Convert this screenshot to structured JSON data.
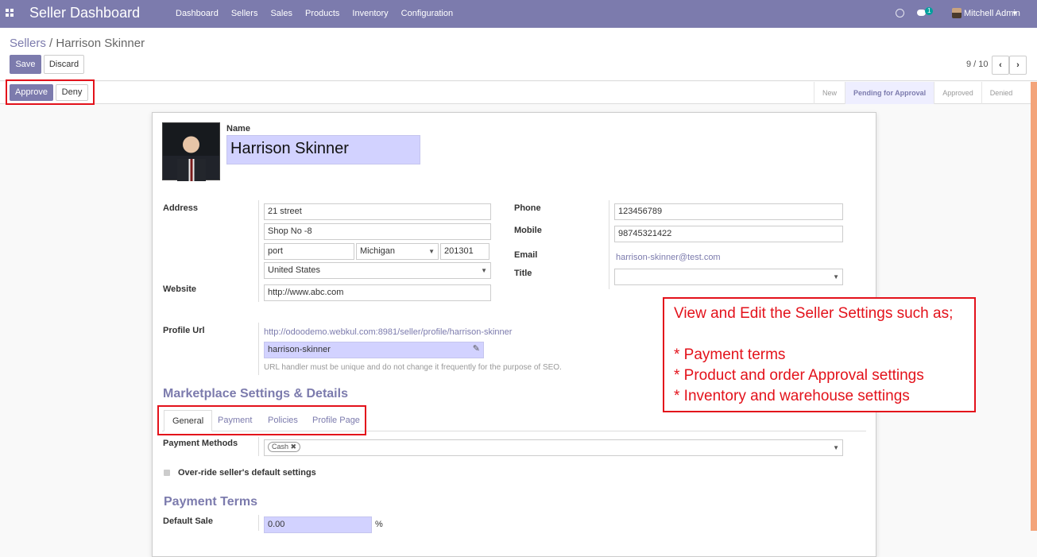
{
  "navbar": {
    "brand": "Seller Dashboard",
    "menu": [
      "Dashboard",
      "Sellers",
      "Sales",
      "Products",
      "Inventory",
      "Configuration"
    ],
    "chat_count": "1",
    "user": "Mitchell Admin"
  },
  "breadcrumb": {
    "parent": "Sellers",
    "separator": " / ",
    "current": "Harrison Skinner"
  },
  "toolbar": {
    "save": "Save",
    "discard": "Discard"
  },
  "pager": {
    "text": "9 / 10"
  },
  "status": {
    "approve": "Approve",
    "deny": "Deny",
    "steps": [
      "New",
      "Pending for Approval",
      "Approved",
      "Denied"
    ],
    "active": "Pending for Approval"
  },
  "form": {
    "name_label": "Name",
    "name": "Harrison Skinner",
    "address_label": "Address",
    "street": "21 street",
    "street2": "Shop No -8",
    "city": "port",
    "state": "Michigan",
    "zip": "201301",
    "country": "United States",
    "website_label": "Website",
    "website": "http://www.abc.com",
    "phone_label": "Phone",
    "phone": "123456789",
    "mobile_label": "Mobile",
    "mobile": "98745321422",
    "email_label": "Email",
    "email": "harrison-skinner@test.com",
    "title_label": "Title",
    "title": "",
    "profile_url_label": "Profile Url",
    "profile_url": "http://odoodemo.webkul.com:8981/seller/profile/harrison-skinner",
    "profile_handle": "harrison-skinner",
    "profile_help": "URL handler must be unique and do not change it frequently for the purpose of SEO.",
    "marketplace_heading": "Marketplace Settings & Details",
    "tabs": [
      "General",
      "Payment",
      "Policies",
      "Profile Page"
    ],
    "payment_methods_label": "Payment Methods",
    "payment_method_tag": "Cash",
    "override_label": "Over-ride seller's default settings",
    "payment_terms_heading": "Payment Terms",
    "default_sale_label": "Default Sale",
    "default_sale_value": "0.00",
    "percent": "%"
  },
  "annotation": {
    "lines": [
      "View and Edit the Seller Settings such as;",
      "",
      "* Payment terms",
      "* Product and order Approval settings",
      "* Inventory and warehouse settings"
    ]
  }
}
